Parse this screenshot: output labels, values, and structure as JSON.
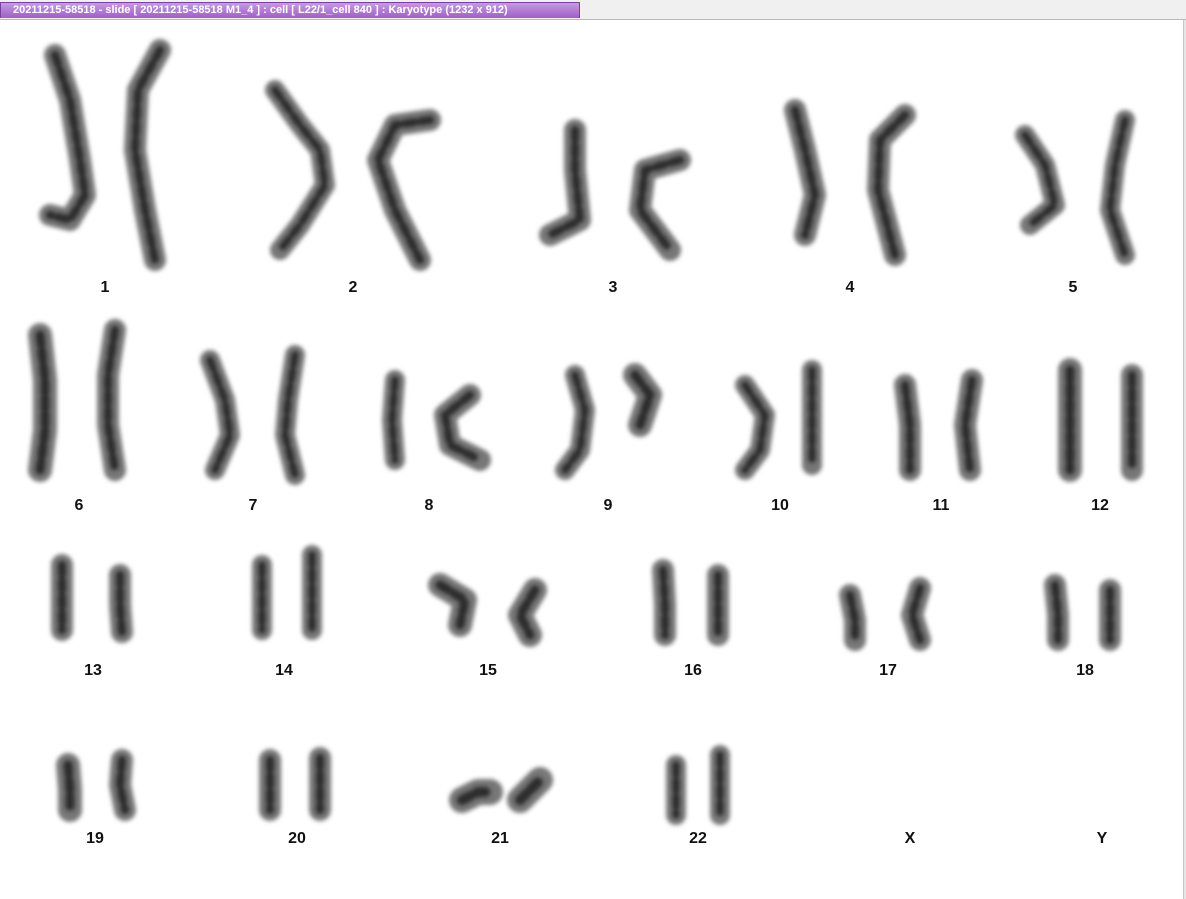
{
  "window": {
    "title": "20211215-58518 - slide [ 20211215-58518 M1_4 ] : cell [ L22/1_cell 840 ] : Karyotype  (1232 x 912)"
  },
  "colors": {
    "title_tab": "#b57ad6",
    "chromosome": "#3a3a3a",
    "label": "#111111"
  },
  "karyotype": {
    "labels": [
      "1",
      "2",
      "3",
      "4",
      "5",
      "6",
      "7",
      "8",
      "9",
      "10",
      "11",
      "12",
      "13",
      "14",
      "15",
      "16",
      "17",
      "18",
      "19",
      "20",
      "21",
      "22",
      "X",
      "Y"
    ]
  }
}
